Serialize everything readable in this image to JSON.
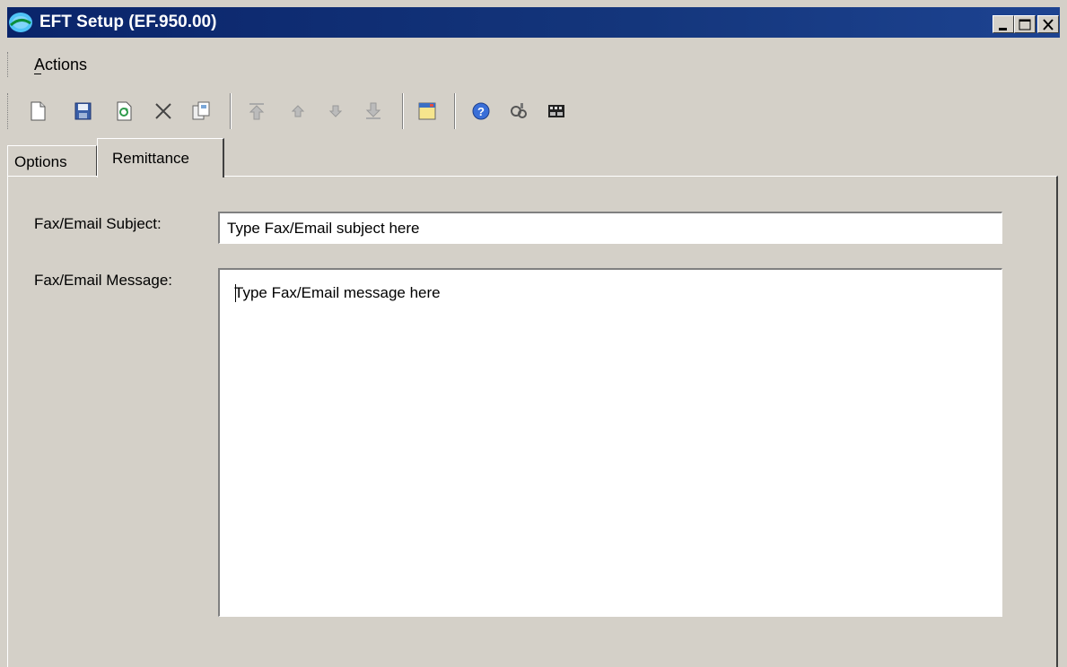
{
  "window": {
    "title": "EFT Setup (EF.950.00)",
    "title_color": "#0a246a"
  },
  "menu": {
    "items": [
      "Actions"
    ]
  },
  "toolbar": {
    "icons": [
      "new-icon",
      "save-icon",
      "refresh-icon",
      "delete-icon",
      "copy-icon",
      "first-icon",
      "previous-icon",
      "next-icon",
      "last-icon",
      "window-icon",
      "help-icon",
      "wizard-icon",
      "film-icon"
    ]
  },
  "tabs": [
    {
      "label": "Options",
      "selected": false
    },
    {
      "label": "Remittance",
      "selected": true
    }
  ],
  "form": {
    "subject_label": "Fax/Email Subject:",
    "subject_value": "Type Fax/Email subject here",
    "message_label": "Fax/Email Message:",
    "message_value": "Type Fax/Email message here"
  }
}
